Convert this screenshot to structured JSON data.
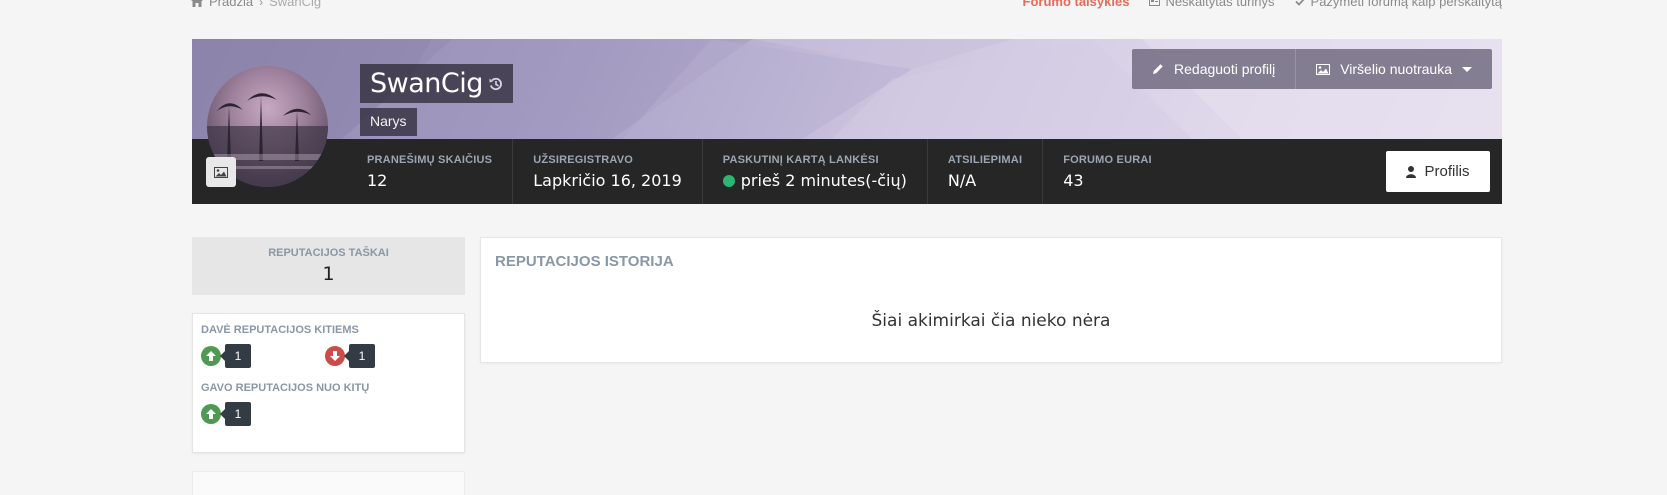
{
  "breadcrumb": {
    "home": "Pradžia",
    "current": "SwanCig"
  },
  "top_links": {
    "rules": "Forumo taisyklės",
    "unread": "Neskaitytas turinys",
    "mark_read": "Pažymėti forumą kaip perskaitytą"
  },
  "profile": {
    "name": "SwanCig",
    "role": "Narys",
    "edit_profile": "Redaguoti profilį",
    "cover_photo": "Viršelio nuotrauka",
    "profile_button": "Profilis"
  },
  "stats": [
    {
      "label": "PRANEŠIMŲ SKAIČIUS",
      "value": "12"
    },
    {
      "label": "UŽSIREGISTRAVO",
      "value": "Lapkričio 16, 2019"
    },
    {
      "label": "PASKUTINĮ KARTĄ LANKĖSI",
      "value": "prieš 2 minutes(-čių)"
    },
    {
      "label": "ATSILIEPIMAI",
      "value": "N/A"
    },
    {
      "label": "FORUMO EURAI",
      "value": "43"
    }
  ],
  "reputation": {
    "points_label": "REPUTACIJOS TAŠKAI",
    "points_value": "1",
    "gave_label": "DAVĖ REPUTACIJOS KITIEMS",
    "gave_up": "1",
    "gave_down": "1",
    "received_label": "GAVO REPUTACIJOS NUO KITŲ",
    "received_up": "1"
  },
  "history": {
    "title": "REPUTACIJOS ISTORIJA",
    "empty": "Šiai akimirkai čia nieko nėra"
  },
  "colors": {
    "accent_rules": "#e46c5b",
    "stats_bg": "#262626",
    "online": "#2bb673",
    "vote_up": "#4e9a53",
    "vote_down": "#cc4c4c"
  }
}
